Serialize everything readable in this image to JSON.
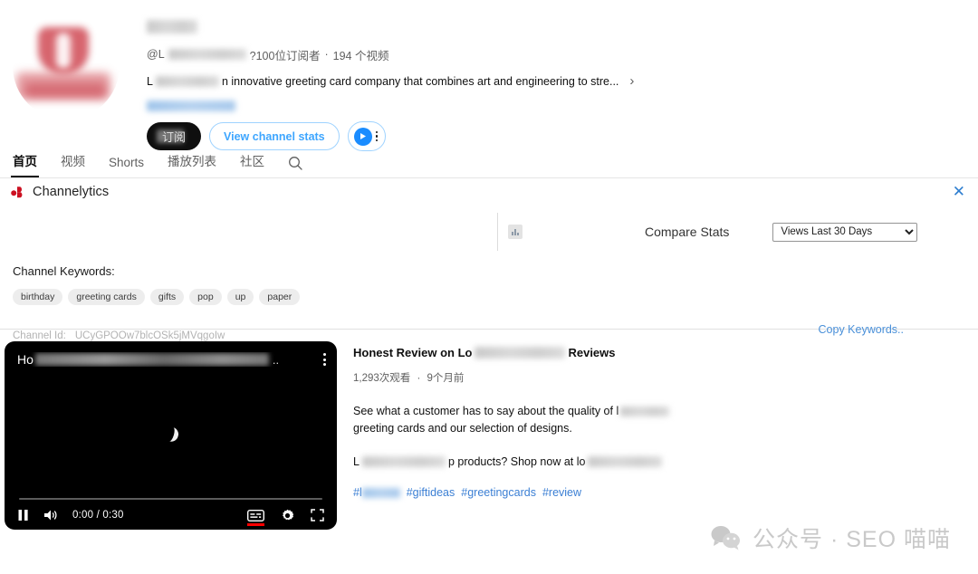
{
  "channel": {
    "handle_prefix": "@L",
    "subscribers": "?100位订阅者",
    "separator": "·",
    "videos": "194 个视频",
    "description_lead": "L",
    "description": "n innovative greeting card company that combines art and engineering to stre...",
    "desc_arrow": "›",
    "subscribe_label": "订阅",
    "stats_button_label": "View channel stats",
    "play_icon": "play-icon",
    "more_icon": "kebab-menu-icon"
  },
  "tabs": [
    {
      "label": "首页",
      "active": true
    },
    {
      "label": "视频",
      "active": false
    },
    {
      "label": "Shorts",
      "active": false
    },
    {
      "label": "播放列表",
      "active": false
    },
    {
      "label": "社区",
      "active": false
    }
  ],
  "tab_search_icon": "search-icon",
  "channelytics": {
    "title": "Channelytics",
    "logo_icon": "channelytics-logo-icon",
    "close_label": "✕",
    "chart_icon": "bar-chart-icon",
    "compare_label": "Compare Stats",
    "select_value": "Views Last 30 Days",
    "select_options": [
      "Views Last 30 Days"
    ],
    "keywords_label": "Channel Keywords:",
    "keywords": [
      "birthday",
      "greeting cards",
      "gifts",
      "pop",
      "up",
      "paper"
    ],
    "copy_keywords_label": "Copy Keywords..",
    "channel_id_label": "Channel Id:",
    "channel_id_value": "UCyGPOOw7blcOSk5jMVqgoIw"
  },
  "player": {
    "title_prefix": "Ho",
    "title_suffix": "..",
    "time": "0:00 / 0:30",
    "pause_icon": "pause-icon",
    "volume_icon": "volume-icon",
    "captions_icon": "captions-icon",
    "settings_icon": "settings-gear-icon",
    "fullscreen_icon": "fullscreen-icon",
    "kebab_icon": "kebab-menu-icon"
  },
  "video": {
    "title_prefix": "Honest Review on Lo",
    "title_suffix": "Reviews",
    "views": "1,293次观看",
    "views_separator": "·",
    "age": "9个月前",
    "description_line1": "See what a customer has to say about the quality of l",
    "description_line2": "greeting cards and our selection of designs.",
    "description_line3_prefix": "L",
    "description_line3_mid": "p products? Shop now at lo",
    "hashtag_prefix": "#l",
    "hashtags": [
      "#giftideas",
      "#greetingcards",
      "#review"
    ]
  },
  "watermark": {
    "icon": "wechat-icon",
    "text": "公众号 · SEO 喵喵"
  },
  "colors": {
    "accent_blue": "#3ea6ff",
    "link_blue": "#4a90d9",
    "brand_red": "#cc0000",
    "dark": "#0f0f0f"
  }
}
